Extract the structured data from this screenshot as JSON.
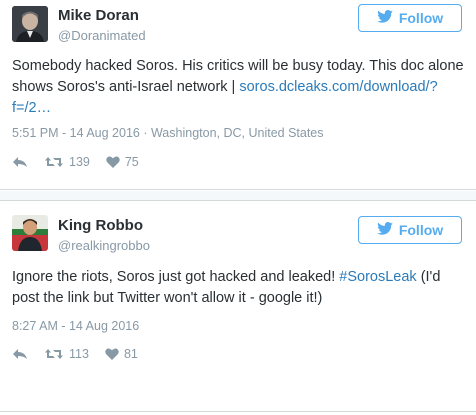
{
  "colors": {
    "accent": "#55acee",
    "link": "#2b7bb9",
    "muted": "#8899a6",
    "text": "#292f33"
  },
  "tweets": [
    {
      "name": "Mike Doran",
      "handle": "@Doranimated",
      "follow_label": "Follow",
      "text": "Somebody hacked Soros. His critics will be busy today. This doc alone shows Soros's anti-Israel network |",
      "link": "soros.dcleaks.com/download/?f=/2…",
      "meta": "5:51 PM - 14 Aug 2016 · Washington, DC, United States",
      "retweets": "139",
      "likes": "75"
    },
    {
      "name": "King Robbo",
      "handle": "@realkingrobbo",
      "follow_label": "Follow",
      "text_before": "Ignore the riots, Soros just got hacked and leaked! ",
      "hashtag": "#SorosLeak",
      "text_after": "(I'd post the link but Twitter won't allow it - google it!)",
      "meta": "8:27 AM - 14 Aug 2016",
      "retweets": "113",
      "likes": "81"
    }
  ]
}
